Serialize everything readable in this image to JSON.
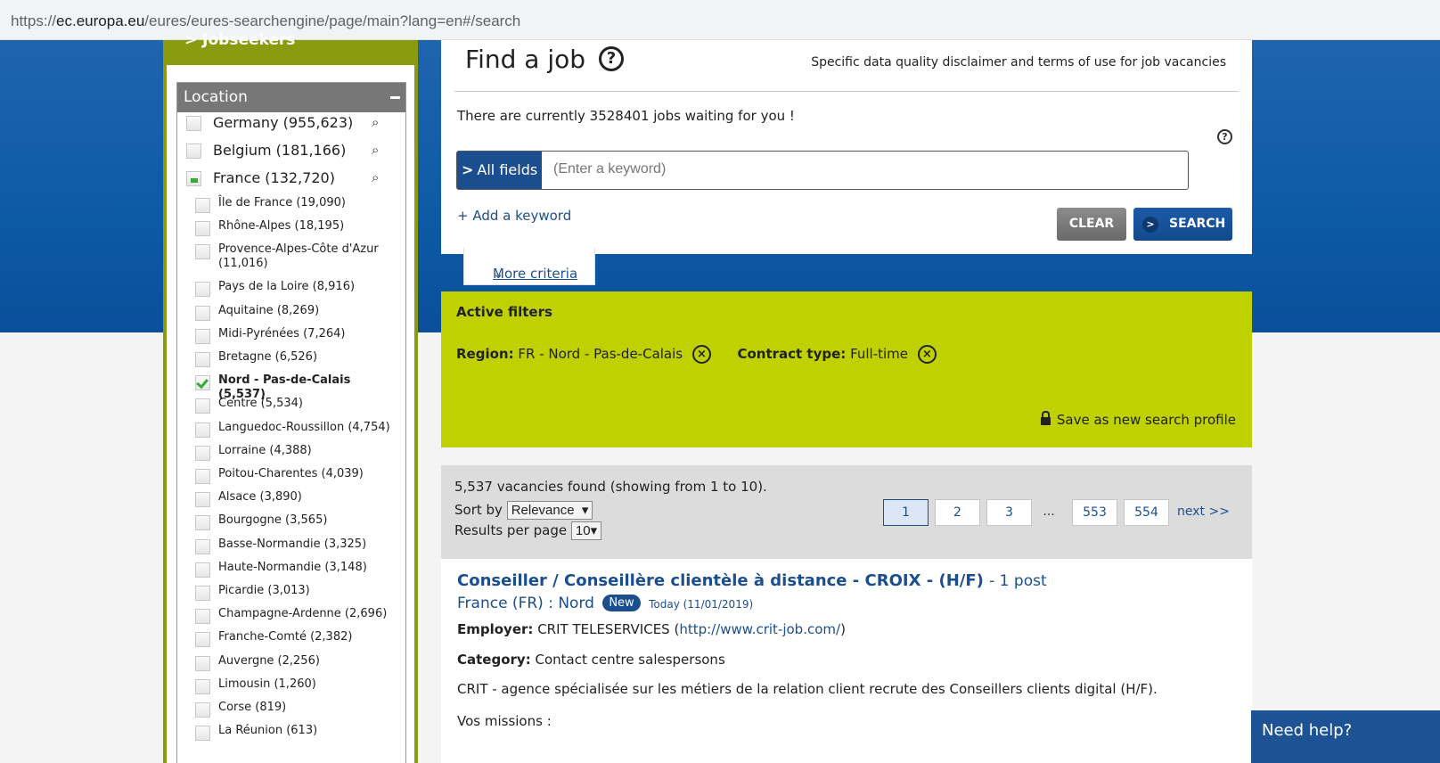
{
  "browser": {
    "url_scheme": "https://",
    "url_host": "ec.europa.eu",
    "url_path": "/eures/eures-searchengine/page/main?lang=en#/search"
  },
  "sidebar": {
    "jobseekers_label": "> Jobseekers",
    "location": {
      "header": "Location",
      "countries": [
        {
          "label": "Germany (955,623)",
          "checked": false
        },
        {
          "label": "Belgium (181,166)",
          "checked": false
        },
        {
          "label": "France (132,720)",
          "checked": true
        }
      ],
      "regions": [
        {
          "label": "Île de France (19,090)"
        },
        {
          "label": "Rhône-Alpes (18,195)"
        },
        {
          "label": "Provence-Alpes-Côte d'Azur (11,016)"
        },
        {
          "label": "Pays de la Loire (8,916)"
        },
        {
          "label": "Aquitaine (8,269)"
        },
        {
          "label": "Midi-Pyrénées (7,264)"
        },
        {
          "label": "Bretagne (6,526)"
        },
        {
          "label": "Nord - Pas-de-Calais (5,537)",
          "checked": true
        },
        {
          "label": "Centre (5,534)"
        },
        {
          "label": "Languedoc-Roussillon (4,754)"
        },
        {
          "label": "Lorraine (4,388)"
        },
        {
          "label": "Poitou-Charentes (4,039)"
        },
        {
          "label": "Alsace (3,890)"
        },
        {
          "label": "Bourgogne (3,565)"
        },
        {
          "label": "Basse-Normandie (3,325)"
        },
        {
          "label": "Haute-Normandie (3,148)"
        },
        {
          "label": "Picardie (3,013)"
        },
        {
          "label": "Champagne-Ardenne (2,696)"
        },
        {
          "label": "Franche-Comté (2,382)"
        },
        {
          "label": "Auvergne (2,256)"
        },
        {
          "label": "Limousin (1,260)"
        },
        {
          "label": "Corse (819)"
        },
        {
          "label": "La Réunion (613)"
        }
      ]
    }
  },
  "search": {
    "title": "Find a job",
    "help_glyph": "?",
    "disclaimer": "Specific data quality disclaimer and terms of use for job vacancies",
    "jobs_waiting": "There are currently 3528401 jobs waiting for you !",
    "field_selector": "All fields",
    "placeholder": "(Enter a keyword)",
    "add_keyword": "+ Add a keyword",
    "clear_label": "CLEAR",
    "search_label": "SEARCH",
    "more_criteria": "More criteria"
  },
  "filters": {
    "title": "Active filters",
    "region_key": "Region:",
    "region_value": "FR - Nord - Pas-de-Calais",
    "contract_key": "Contract type:",
    "contract_value": "Full-time",
    "save_profile": "Save as new search profile"
  },
  "results": {
    "found_text": "5,537 vacancies found (showing from 1 to 10).",
    "sort_label": "Sort by",
    "sort_value": "Relevance",
    "per_page_label": "Results per page",
    "per_page_value": "10",
    "pages": [
      "1",
      "2",
      "3",
      "...",
      "553",
      "554"
    ],
    "active_page": "1",
    "next_label": "next >>"
  },
  "job": {
    "title": "Conseiller / Conseillère clientèle à distance - CROIX - (H/F)",
    "posts": "- 1 post",
    "location": "France (FR) : Nord",
    "badge": "New",
    "date": "Today (11/01/2019)",
    "employer_key": "Employer:",
    "employer_name": "CRIT TELESERVICES",
    "employer_url": "http://www.crit-job.com/",
    "category_key": "Category:",
    "category_value": "Contact centre salespersons",
    "description": "CRIT - agence spécialisée sur les métiers de la relation client recrute des Conseillers clients digital (H/F).",
    "missions": "Vos missions :"
  },
  "help_widget": {
    "label": "Need help?"
  },
  "colors": {
    "brand_blue": "#1b4e8f",
    "filter_green": "#bfd100",
    "sidebar_olive": "#8a9b0f"
  }
}
